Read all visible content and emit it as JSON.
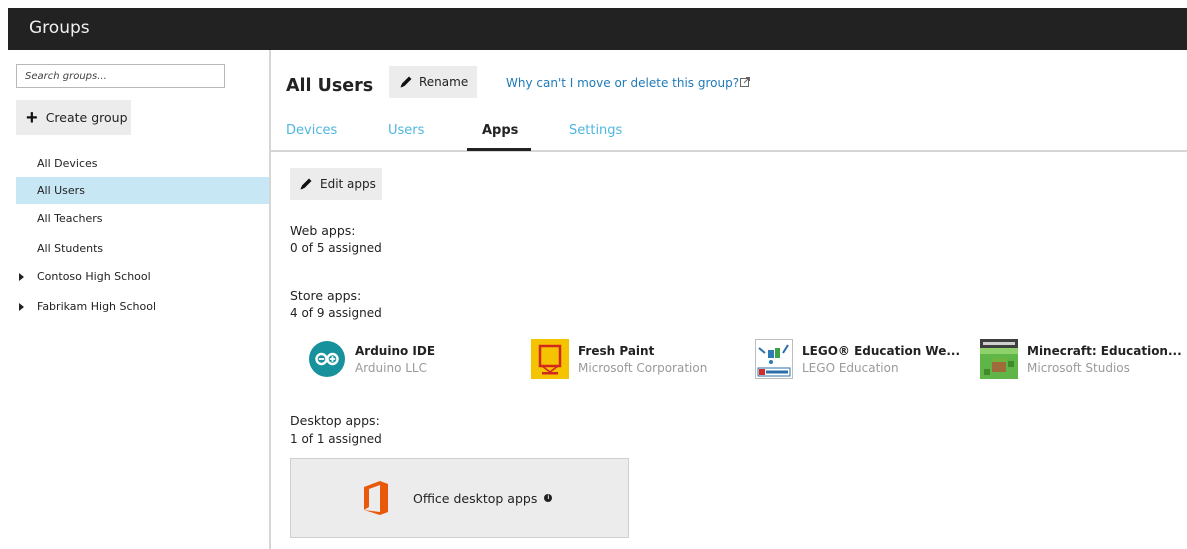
{
  "header": {
    "title": "Groups"
  },
  "sidebar": {
    "search_placeholder": "Search groups...",
    "create_label": "Create group",
    "items": [
      {
        "label": "All Devices"
      },
      {
        "label": "All Users"
      },
      {
        "label": "All Teachers"
      },
      {
        "label": "All Students"
      },
      {
        "label": "Contoso High School"
      },
      {
        "label": "Fabrikam High School"
      }
    ],
    "active_index": 1
  },
  "main": {
    "group_title": "All Users",
    "rename_label": "Rename",
    "why_link": "Why can't I move or delete this group?",
    "tabs": [
      {
        "label": "Devices"
      },
      {
        "label": "Users"
      },
      {
        "label": "Apps"
      },
      {
        "label": "Settings"
      }
    ],
    "active_tab": "Apps",
    "edit_apps_label": "Edit apps",
    "web_apps": {
      "label": "Web apps:",
      "count": "0 of 5 assigned"
    },
    "store_apps": {
      "label": "Store apps:",
      "count": "4 of 9 assigned",
      "items": [
        {
          "name": "Arduino IDE",
          "publisher": "Arduino LLC",
          "icon": "arduino-icon"
        },
        {
          "name": "Fresh Paint",
          "publisher": "Microsoft Corporation",
          "icon": "fresh-paint-icon"
        },
        {
          "name": "LEGO® Education We...",
          "publisher": "LEGO Education",
          "icon": "lego-education-icon"
        },
        {
          "name": "Minecraft: Education...",
          "publisher": "Microsoft Studios",
          "icon": "minecraft-icon"
        }
      ]
    },
    "desktop_apps": {
      "label": "Desktop apps:",
      "count": "1 of 1 assigned",
      "tile_label": "Office desktop apps"
    }
  },
  "colors": {
    "topbar": "#222222",
    "active_nav": "#c7e7f5",
    "tab_link": "#4fb6e0",
    "link": "#1e7ab8",
    "office_orange": "#e8590c"
  }
}
